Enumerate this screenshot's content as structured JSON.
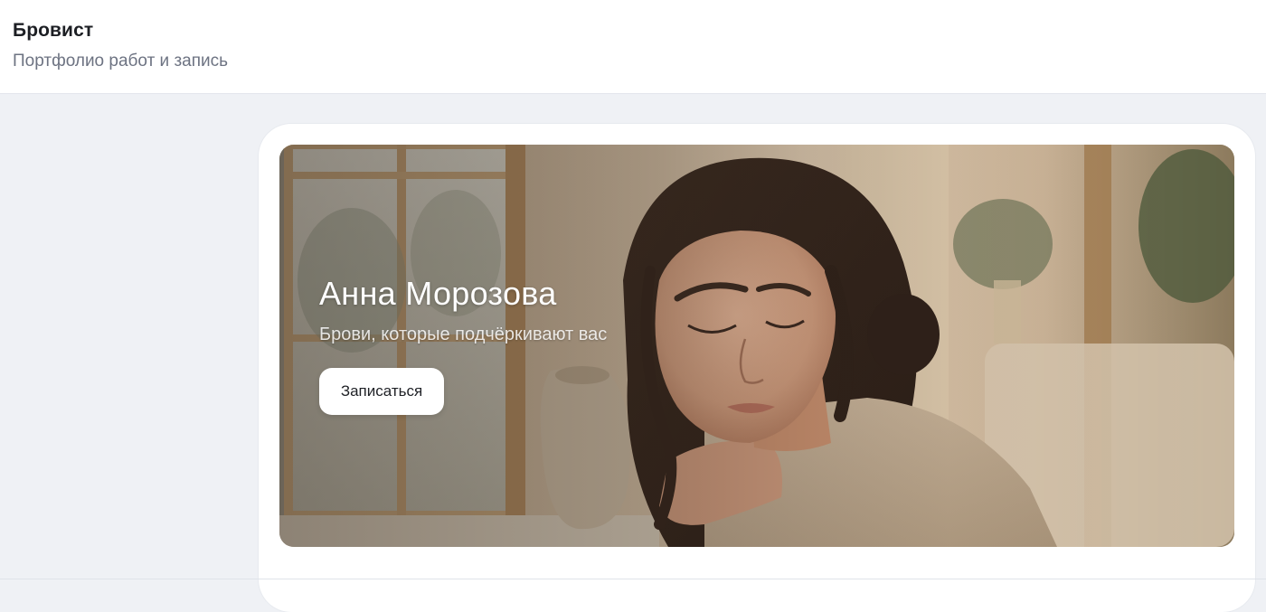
{
  "header": {
    "title": "Бровист",
    "subtitle": "Портфолио работ и запись"
  },
  "hero": {
    "name": "Анна Морозова",
    "tagline": "Брови, которые подчёркивают вас",
    "cta_label": "Записаться",
    "image_description_icon": "portrait-photo"
  },
  "colors": {
    "page_background": "#eff1f5",
    "header_background": "#ffffff",
    "card_background": "#ffffff",
    "button_background": "#ffffff",
    "title_text": "#1d1f24",
    "subtitle_text": "#6d7382"
  }
}
